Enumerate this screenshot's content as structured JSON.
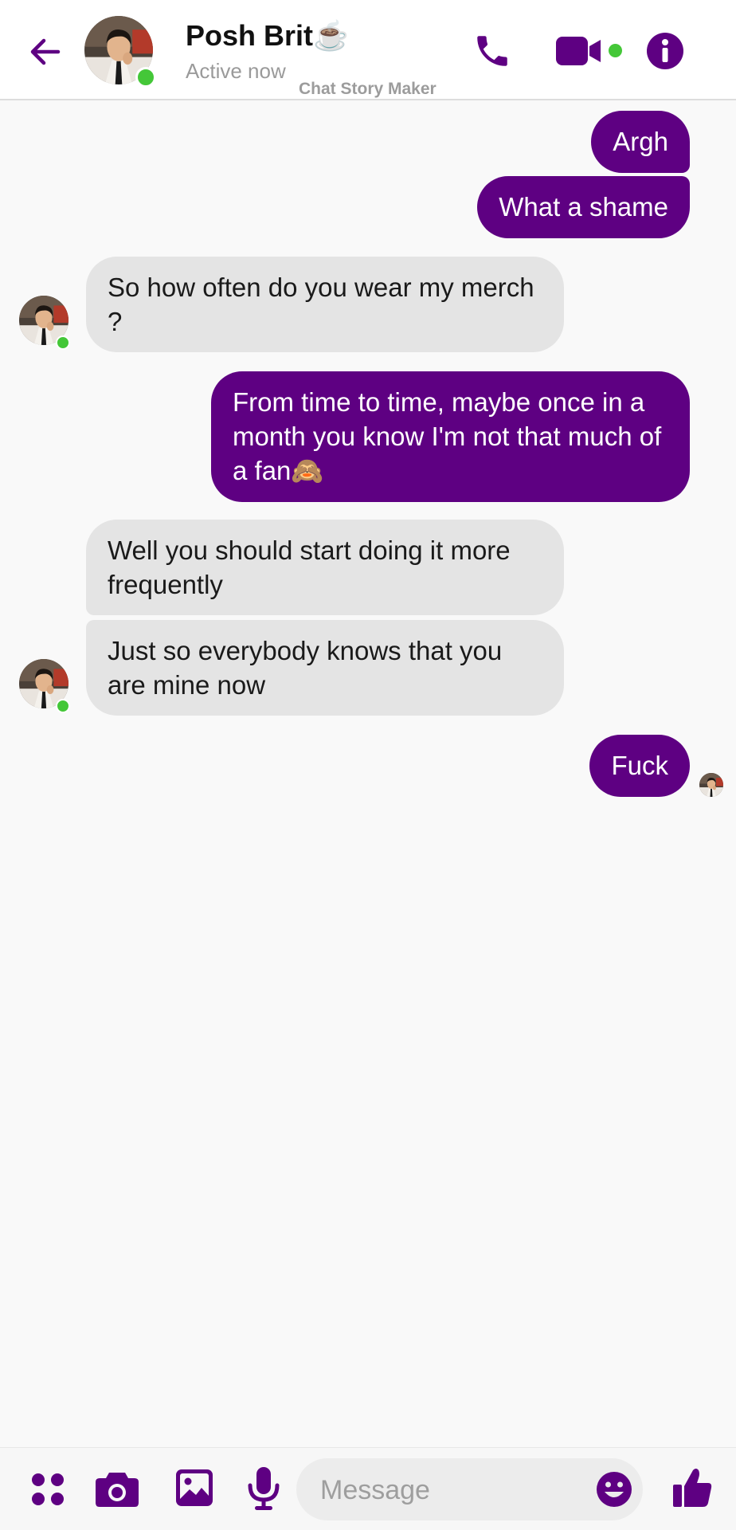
{
  "header": {
    "contact_name": "Posh Brit☕",
    "status": "Active now",
    "watermark": "Chat Story Maker"
  },
  "icons": {
    "back": "arrow-left-icon",
    "call": "phone-icon",
    "video": "video-camera-icon",
    "info": "info-icon",
    "apps": "four-dots-icon",
    "camera": "camera-icon",
    "gallery": "image-icon",
    "mic": "microphone-icon",
    "emoji": "smiley-icon",
    "like": "thumbs-up-icon"
  },
  "messages": [
    {
      "from": "me",
      "text": "Argh"
    },
    {
      "from": "me",
      "text": "What a shame"
    },
    {
      "from": "them",
      "text": "So how often do you wear my merch ?"
    },
    {
      "from": "me",
      "text": "From time to time, maybe once in a month you know I'm not that much of a fan🙈"
    },
    {
      "from": "them",
      "text": "Well you should start doing it more frequently"
    },
    {
      "from": "them",
      "text": "Just so everybody knows that you are mine now"
    },
    {
      "from": "me",
      "text": "Fuck"
    }
  ],
  "composer": {
    "placeholder": "Message"
  },
  "colors": {
    "accent": "#5e0082",
    "online": "#44c738",
    "received_bubble": "#e4e4e4",
    "background": "#f9f9f9"
  }
}
